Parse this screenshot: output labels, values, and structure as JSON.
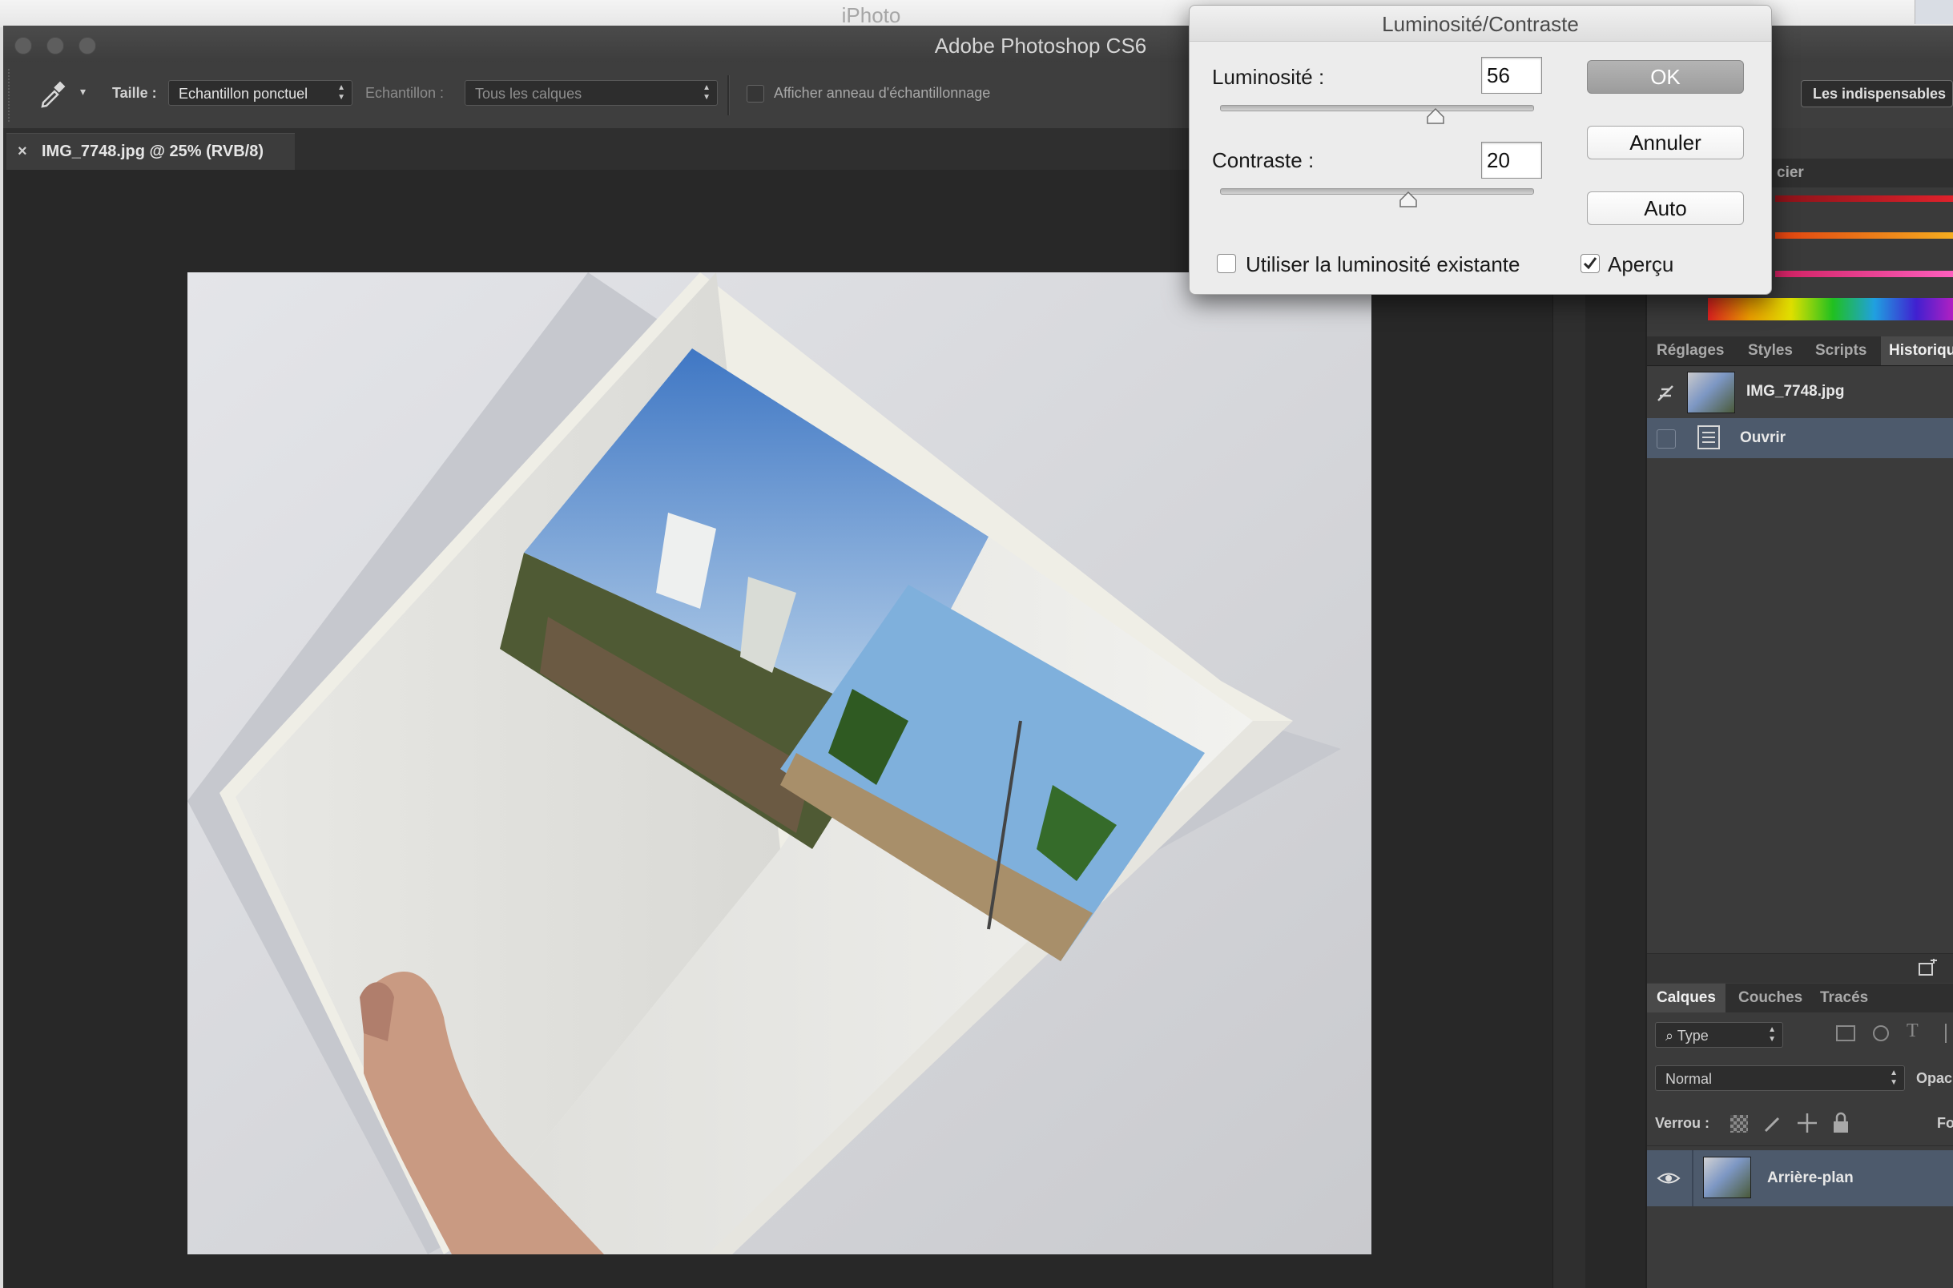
{
  "system": {
    "window_title": "iPhoto"
  },
  "app": {
    "title": "Adobe Photoshop CS6"
  },
  "options_bar": {
    "size_label": "Taille :",
    "size_value": "Echantillon ponctuel",
    "sample_label": "Echantillon :",
    "sample_value": "Tous les calques",
    "ring_label": "Afficher anneau d'échantillonnage",
    "workspace": "Les indispensables"
  },
  "document": {
    "close_glyph": "×",
    "tab_label": "IMG_7748.jpg @ 25% (RVB/8)"
  },
  "panels": {
    "swatch_tab_partial": "cier",
    "history_tabs": [
      "Réglages",
      "Styles",
      "Scripts",
      "Historique"
    ],
    "history_items": [
      {
        "label": "IMG_7748.jpg"
      },
      {
        "label": "Ouvrir"
      }
    ],
    "layer_tabs": [
      "Calques",
      "Couches",
      "Tracés"
    ],
    "filter_value": "Type",
    "blend_mode": "Normal",
    "opacity_label_partial": "Opac",
    "lock_label": "Verrou :",
    "fill_label_partial": "Fo",
    "layers": [
      {
        "name": "Arrière-plan"
      }
    ]
  },
  "dialog": {
    "title": "Luminosité/Contraste",
    "brightness_label": "Luminosité :",
    "brightness_value": "56",
    "contrast_label": "Contraste :",
    "contrast_value": "20",
    "ok_label": "OK",
    "cancel_label": "Annuler",
    "auto_label": "Auto",
    "legacy_label": "Utiliser la luminosité existante",
    "preview_label": "Aperçu",
    "legacy_checked": false,
    "preview_checked": true
  },
  "colors": {
    "app_dark": "#282828",
    "panel_bg": "#3b3b3b",
    "selection": "#4d5a6c",
    "dialog_bg": "#ececec"
  }
}
